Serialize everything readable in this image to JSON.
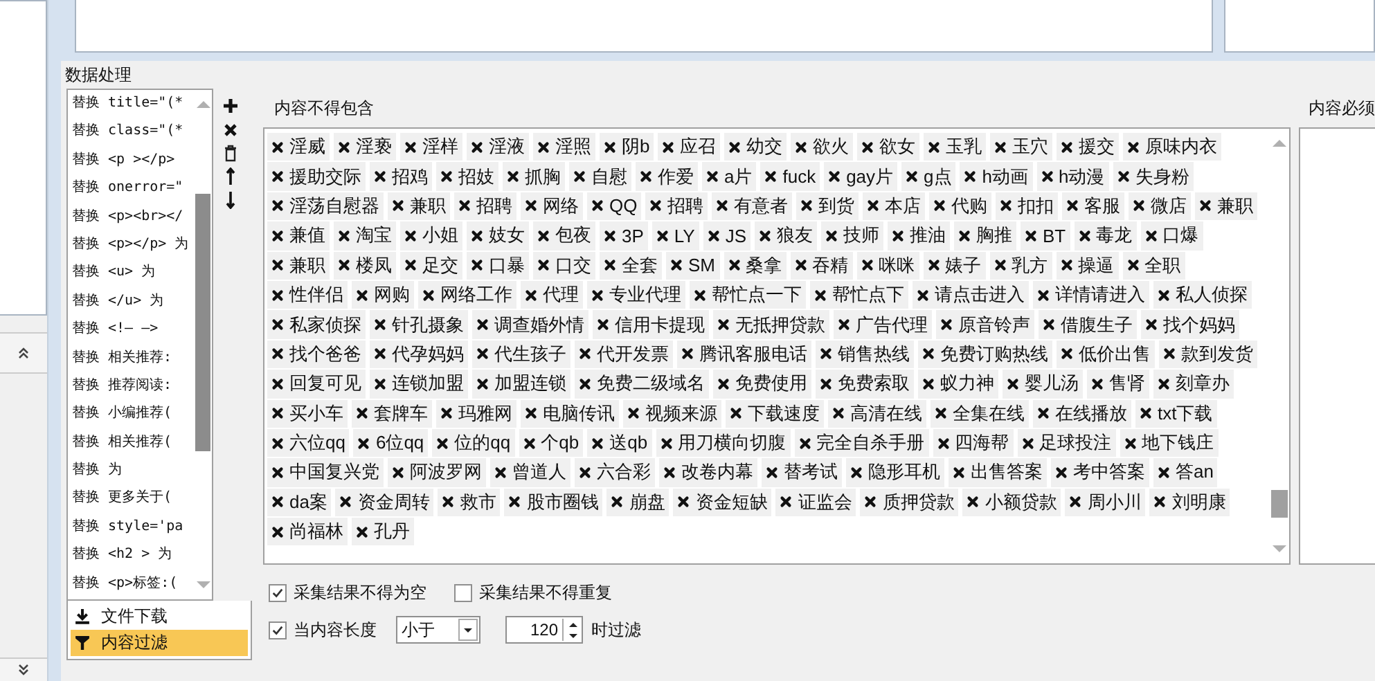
{
  "section_title": "数据处理",
  "rules": [
    "替换 title=\"(*",
    "替换 class=\"(*",
    "替换 <p ></p>",
    "替换 onerror=\"",
    "替换 <p><br></",
    "替换 <p></p> 为",
    "替换 <u> 为",
    "替换 </u> 为",
    "替换 <!— —>",
    "替换 相关推荐:",
    "替换 推荐阅读:",
    "替换 小编推荐(",
    "替换 相关推荐(",
    "替换  为",
    "替换 更多关于(",
    "替换 style='pa",
    "替换 <h2 > 为",
    "替换 <p>标签:("
  ],
  "modules": [
    {
      "label": "文件下载",
      "kind": "download",
      "selected": false
    },
    {
      "label": "内容过滤",
      "kind": "filter",
      "selected": true
    }
  ],
  "exclude": {
    "label": "内容不得包含",
    "tags": [
      "淫威",
      "淫亵",
      "淫样",
      "淫液",
      "淫照",
      "阴b",
      "应召",
      "幼交",
      "欲火",
      "欲女",
      "玉乳",
      "玉穴",
      "援交",
      "原味内衣",
      "援助交际",
      "招鸡",
      "招妓",
      "抓胸",
      "自慰",
      "作爱",
      "a片",
      "fuck",
      "gay片",
      "g点",
      "h动画",
      "h动漫",
      "失身粉",
      "淫荡自慰器",
      "兼职",
      "招聘",
      "网络",
      "QQ",
      "招聘",
      "有意者",
      "到货",
      "本店",
      "代购",
      "扣扣",
      "客服",
      "微店",
      "兼职",
      "兼值",
      "淘宝",
      "小姐",
      "妓女",
      "包夜",
      "3P",
      "LY",
      "JS",
      "狼友",
      "技师",
      "推油",
      "胸推",
      "BT",
      "毒龙",
      "口爆",
      "兼职",
      "楼凤",
      "足交",
      "口暴",
      "口交",
      "全套",
      "SM",
      "桑拿",
      "吞精",
      "咪咪",
      "婊子",
      "乳方",
      "操逼",
      "全职",
      "性伴侣",
      "网购",
      "网络工作",
      "代理",
      "专业代理",
      "帮忙点一下",
      "帮忙点下",
      "请点击进入",
      "详情请进入",
      "私人侦探",
      "私家侦探",
      "针孔摄象",
      "调查婚外情",
      "信用卡提现",
      "无抵押贷款",
      "广告代理",
      "原音铃声",
      "借腹生子",
      "找个妈妈",
      "找个爸爸",
      "代孕妈妈",
      "代生孩子",
      "代开发票",
      "腾讯客服电话",
      "销售热线",
      "免费订购热线",
      "低价出售",
      "款到发货",
      "回复可见",
      "连锁加盟",
      "加盟连锁",
      "免费二级域名",
      "免费使用",
      "免费索取",
      "蚁力神",
      "婴儿汤",
      "售肾",
      "刻章办",
      "买小车",
      "套牌车",
      "玛雅网",
      "电脑传讯",
      "视频来源",
      "下载速度",
      "高清在线",
      "全集在线",
      "在线播放",
      "txt下载",
      "六位qq",
      "6位qq",
      "位的qq",
      "个qb",
      "送qb",
      "用刀横向切腹",
      "完全自杀手册",
      "四海帮",
      "足球投注",
      "地下钱庄",
      "中国复兴党",
      "阿波罗网",
      "曾道人",
      "六合彩",
      "改卷内幕",
      "替考试",
      "隐形耳机",
      "出售答案",
      "考中答案",
      "答an",
      "da案",
      "资金周转",
      "救市",
      "股市圈钱",
      "崩盘",
      "资金短缺",
      "证监会",
      "质押贷款",
      "小额贷款",
      "周小川",
      "刘明康",
      "尚福林",
      "孔丹"
    ]
  },
  "include": {
    "label": "内容必须"
  },
  "options": [
    {
      "label": "采集结果不得为空",
      "checked": true
    },
    {
      "label": "采集结果不得重复",
      "checked": false
    }
  ],
  "length_filter": {
    "checked": true,
    "label": "当内容长度",
    "operator": "小于",
    "value": "120",
    "suffix": "时过滤"
  }
}
